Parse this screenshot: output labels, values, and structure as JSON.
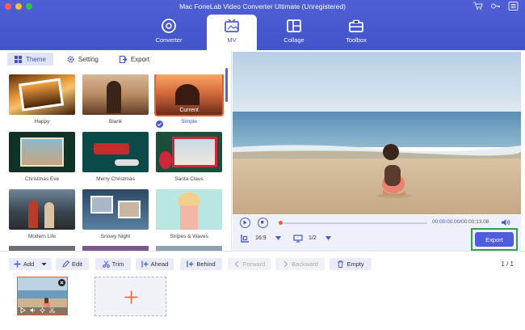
{
  "window": {
    "title": "Mac FoneLab Video Converter Ultimate (Unregistered)",
    "traffic_colors": [
      "#ff5f57",
      "#febc2e",
      "#28c840"
    ]
  },
  "top_icons": [
    "cart-icon",
    "key-icon",
    "menu-icon"
  ],
  "nav": {
    "tabs": [
      {
        "label": "Converter",
        "icon": "converter-icon",
        "active": false
      },
      {
        "label": "MV",
        "icon": "mv-icon",
        "active": true
      },
      {
        "label": "Collage",
        "icon": "collage-icon",
        "active": false
      },
      {
        "label": "Toolbox",
        "icon": "toolbox-icon",
        "active": false
      }
    ]
  },
  "left": {
    "tabs": {
      "theme": "Theme",
      "setting": "Setting",
      "export": "Export"
    },
    "themes": [
      {
        "name": "Happy"
      },
      {
        "name": "Blank"
      },
      {
        "name": "Simple",
        "current_label": "Current"
      },
      {
        "name": "Christmas Eve"
      },
      {
        "name": "Merry Christmas"
      },
      {
        "name": "Santa Claus"
      },
      {
        "name": "Modern Life"
      },
      {
        "name": "Snowy Night"
      },
      {
        "name": "Stripes & Waves"
      }
    ]
  },
  "player": {
    "time_current": "00:00:00.00",
    "time_total": "/00:00:13.08",
    "aspect_ratio": "16:9",
    "scale": "1/2",
    "export_label": "Export",
    "progress": 0
  },
  "toolbar": {
    "add": "Add",
    "edit": "Edit",
    "trim": "Trim",
    "ahead": "Ahead",
    "behind": "Behind",
    "forward": "Forward",
    "backward": "Backward",
    "empty": "Empty",
    "page": "1 / 1"
  },
  "colors": {
    "accent": "#4f5ddc",
    "selection": "#f05b3a",
    "highlight": "#3c9c4e"
  }
}
